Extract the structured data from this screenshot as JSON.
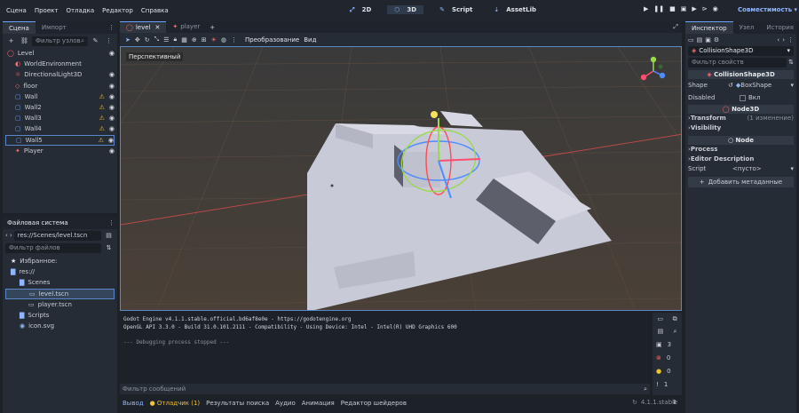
{
  "menubar": {
    "items": [
      "Сцена",
      "Проект",
      "Отладка",
      "Редактор",
      "Справка"
    ]
  },
  "workspaces": [
    "2D",
    "3D",
    "Script",
    "AssetLib"
  ],
  "renderer": "Совместимость",
  "scene_panel": {
    "tabs": [
      "Сцена",
      "Импорт"
    ],
    "filter": "Фильтр узлов",
    "nodes": [
      {
        "label": "Level",
        "icon": "node3d-icon",
        "depth": 0,
        "warn": false,
        "eye": true
      },
      {
        "label": "WorldEnvironment",
        "icon": "world-environment-icon",
        "depth": 1,
        "warn": false,
        "eye": false
      },
      {
        "label": "DirectionalLight3D",
        "icon": "directional-light-icon",
        "depth": 1,
        "warn": false,
        "eye": true
      },
      {
        "label": "floor",
        "icon": "mesh-icon",
        "depth": 1,
        "warn": false,
        "eye": true
      },
      {
        "label": "Wall",
        "icon": "static-body-icon",
        "depth": 1,
        "warn": true,
        "eye": true
      },
      {
        "label": "Wall2",
        "icon": "static-body-icon",
        "depth": 1,
        "warn": true,
        "eye": true
      },
      {
        "label": "Wall3",
        "icon": "static-body-icon",
        "depth": 1,
        "warn": true,
        "eye": true
      },
      {
        "label": "Wall4",
        "icon": "static-body-icon",
        "depth": 1,
        "warn": true,
        "eye": true
      },
      {
        "label": "Wall5",
        "icon": "static-body-icon",
        "depth": 1,
        "warn": true,
        "eye": true
      },
      {
        "label": "Player",
        "icon": "player-icon",
        "depth": 1,
        "warn": false,
        "eye": true
      }
    ]
  },
  "filesystem": {
    "title": "Файловая система",
    "path": "res://Scenes/level.tscn",
    "filter": "Фильтр файлов",
    "items": [
      {
        "label": "Избранное:",
        "icon": "star-icon",
        "depth": 0
      },
      {
        "label": "res://",
        "icon": "folder-icon",
        "depth": 0
      },
      {
        "label": "Scenes",
        "icon": "folder-icon",
        "depth": 1
      },
      {
        "label": "level.tscn",
        "icon": "scene-file-icon",
        "depth": 2
      },
      {
        "label": "player.tscn",
        "icon": "scene-file-icon",
        "depth": 2
      },
      {
        "label": "Scripts",
        "icon": "folder-icon",
        "depth": 1
      },
      {
        "label": "icon.svg",
        "icon": "image-file-icon",
        "depth": 1
      }
    ]
  },
  "editor_tabs": [
    "level",
    "player"
  ],
  "viewport_toolbar": {
    "transform": "Преобразование",
    "view": "Вид"
  },
  "viewport": {
    "label": "Перспективный"
  },
  "output": {
    "lines": [
      "Godot Engine v4.1.1.stable.official.bd6af8e0e - https://godotengine.org",
      "OpenGL API 3.3.0 - Build 31.0.101.2111 - Compatibility - Using Device: Intel - Intel(R) UHD Graphics 600",
      "",
      "--- Debugging process stopped ---"
    ],
    "filter": "Фильтр сообщений",
    "counts": [
      "3",
      "0",
      "0",
      "1"
    ]
  },
  "bottom_tabs": [
    "Вывод",
    "Отладчик (1)",
    "Результаты поиска",
    "Аудио",
    "Анимация",
    "Редактор шейдеров"
  ],
  "version": "4.1.1.stable",
  "inspector": {
    "tabs": [
      "Инспектор",
      "Узел",
      "История"
    ],
    "node": "CollisionShape3D",
    "filter": "Фильтр свойств",
    "section1": "CollisionShape3D",
    "shape_label": "Shape",
    "shape_value": "BoxShape",
    "disabled_label": "Disabled",
    "disabled_value": "Вкл",
    "section2": "Node3D",
    "transform": "Transform",
    "transform_note": "(1 изменение)",
    "visibility": "Visibility",
    "section3": "Node",
    "process": "Process",
    "editor_desc": "Editor Description",
    "script_label": "Script",
    "script_value": "<пусто>",
    "add_meta": "Добавить метаданные"
  },
  "colors": {
    "accent": "#6aa0ff",
    "warn": "#f1c232",
    "bg": "#262c35"
  }
}
